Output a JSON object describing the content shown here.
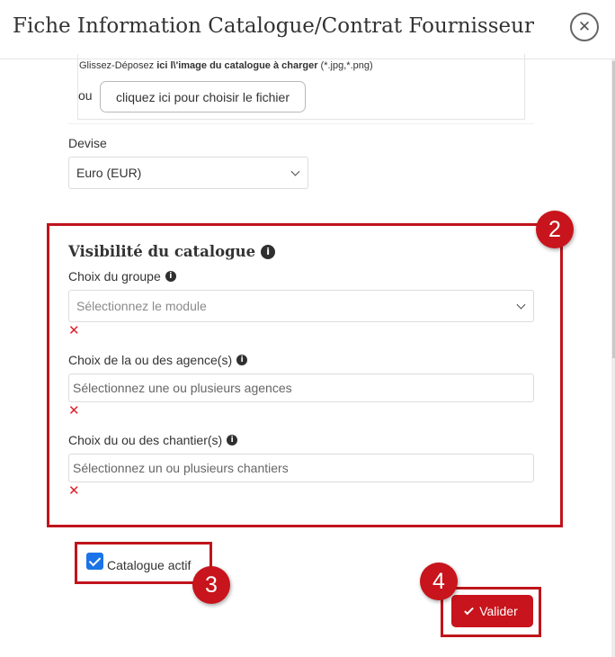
{
  "header": {
    "title": "Fiche Information Catalogue/Contrat Fournisseur",
    "close_icon": "close-circle-icon"
  },
  "upload": {
    "hint_prefix": "Glissez-Déposez ",
    "hint_bold": "ici l\\'image du catalogue à charger",
    "hint_suffix": " (*.jpg,*.png)",
    "or_label": "ou",
    "choose_file_button": "cliquez ici pour choisir le fichier"
  },
  "currency": {
    "label": "Devise",
    "value": "Euro (EUR)"
  },
  "visibility": {
    "title": "Visibilité du catalogue",
    "group": {
      "label": "Choix du groupe",
      "placeholder": "Sélectionnez le module"
    },
    "agencies": {
      "label": "Choix de la ou des agence(s)",
      "placeholder": "Sélectionnez une ou plusieurs agences"
    },
    "sites": {
      "label": "Choix du ou des chantier(s)",
      "placeholder": "Sélectionnez un ou plusieurs chantiers"
    },
    "error_mark": "✕"
  },
  "active": {
    "label": "Catalogue actif",
    "checked": true
  },
  "submit": {
    "label": "Valider"
  },
  "annotations": {
    "badge_2": "2",
    "badge_3": "3",
    "badge_4": "4"
  },
  "colors": {
    "accent_red": "#c8141c",
    "checkbox_blue": "#1a73e8",
    "error_red": "#e0202a"
  }
}
